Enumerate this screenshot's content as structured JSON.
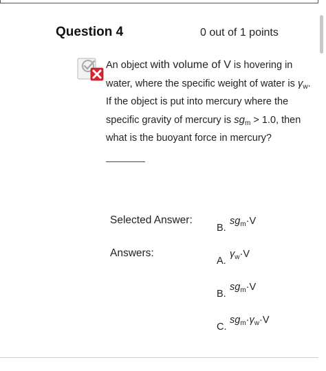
{
  "question": {
    "title": "Question 4",
    "points": "0 out of 1 points",
    "text": {
      "part1": "An object ",
      "part2": "with volume of V",
      "part3": " is hovering in water, where the specific weight of water is",
      "gamma": "γ",
      "gamma_sub": "w",
      "part4": ". If the object is put into mercury where the specific gravity of mercury is ",
      "sg": "sg",
      "sg_sub": "m",
      "part5": " > 1.0, then what is the buoyant force in mercury?"
    }
  },
  "selected_answer": {
    "label": "Selected Answer:",
    "letter": "B.",
    "f_main": "sg",
    "f_sub": "m",
    "f_rest": "·V"
  },
  "answers": {
    "label": "Answers:",
    "items": [
      {
        "letter": "A.",
        "f_main": "γ",
        "f_sub": "w",
        "f_rest": "·V",
        "f_main2": "",
        "f_sub2": "",
        "f_rest2": ""
      },
      {
        "letter": "B.",
        "f_main": "sg",
        "f_sub": "m",
        "f_rest": "·V",
        "f_main2": "",
        "f_sub2": "",
        "f_rest2": ""
      },
      {
        "letter": "C.",
        "f_main": "sg",
        "f_sub": "m",
        "f_rest": "·",
        "f_main2": "γ",
        "f_sub2": "w",
        "f_rest2": "·V"
      }
    ]
  },
  "colors": {
    "incorrect_badge": "#d9232d",
    "icon_gray": "#a9a9a9"
  },
  "icons": {
    "status": "incorrect-icon"
  }
}
